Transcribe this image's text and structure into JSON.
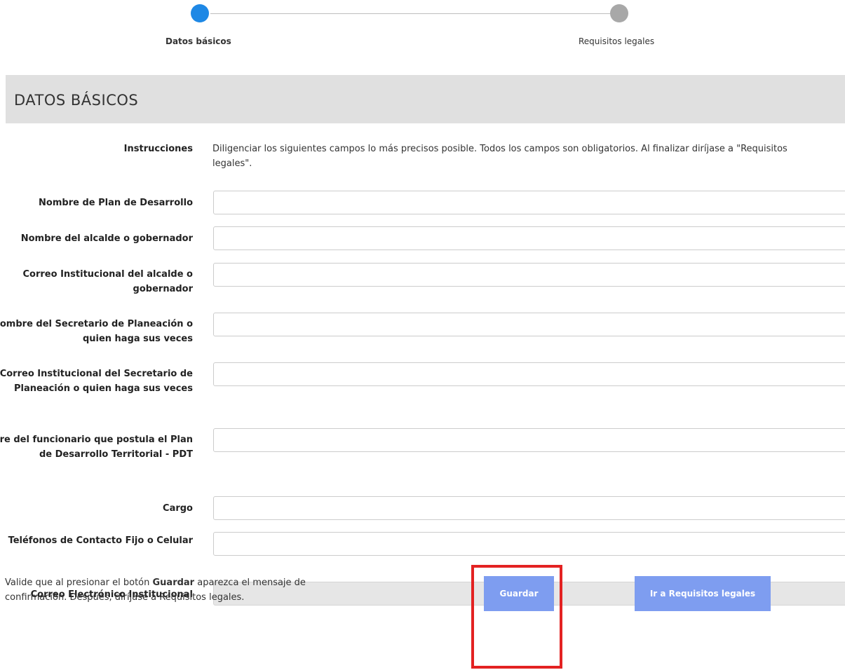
{
  "stepper": {
    "steps": [
      {
        "label": "Datos básicos",
        "state": "active"
      },
      {
        "label": "Requisitos legales",
        "state": "pending"
      }
    ],
    "active_color": "#1e88e5",
    "pending_color": "#a8a8a8"
  },
  "section": {
    "title": "DATOS BÁSICOS"
  },
  "instructions": {
    "label": "Instrucciones",
    "text": "Diligenciar los siguientes campos lo más precisos posible. Todos los campos son obligatorios. Al finalizar diríjase a \"Requisitos legales\"."
  },
  "fields": [
    {
      "label": "Nombre de Plan de Desarrollo",
      "value": ""
    },
    {
      "label": "Nombre del alcalde o gobernador",
      "value": ""
    },
    {
      "label": "Correo Institucional del alcalde o gobernador",
      "value": ""
    },
    {
      "label": "Nombre del Secretario de Planeación o quien haga sus veces",
      "value": ""
    },
    {
      "label": "Correo Institucional del Secretario de Planeación o quien haga sus veces",
      "value": ""
    },
    {
      "label": "Nombre del funcionario que postula el Plan de Desarrollo Territorial - PDT",
      "value": ""
    },
    {
      "label": "Cargo",
      "value": ""
    },
    {
      "label": "Teléfonos de Contacto Fijo o Celular",
      "value": ""
    },
    {
      "label": "Correo Electrónico Institucional",
      "value": "",
      "disabled": true
    }
  ],
  "footer": {
    "note_before": "Valide que al presionar el botón ",
    "note_bold": "Guardar",
    "note_after": " aparezca el mensaje de confirmación. Después, diríjase a Requisitos legales.",
    "save_label": "Guardar",
    "next_label": "Ir a Requisitos legales",
    "button_color": "#7e9df0",
    "highlight_color": "#e32222"
  }
}
